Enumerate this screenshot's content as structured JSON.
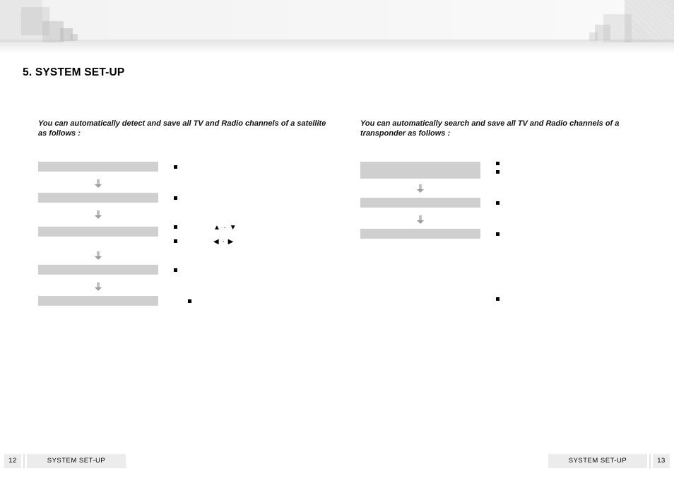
{
  "title": "5. SYSTEM SET-UP",
  "left": {
    "intro": "You can automatically detect and save all TV and Radio channels of a satellite as follows :"
  },
  "right": {
    "intro": "You can automatically search and save all TV and Radio channels of a transponder as follows :"
  },
  "nav": {
    "updown": "▲ · ▼",
    "leftright": "◀ · ▶"
  },
  "footer": {
    "left_page": "12",
    "left_label": "SYSTEM SET-UP",
    "right_label": "SYSTEM SET-UP",
    "right_page": "13"
  }
}
